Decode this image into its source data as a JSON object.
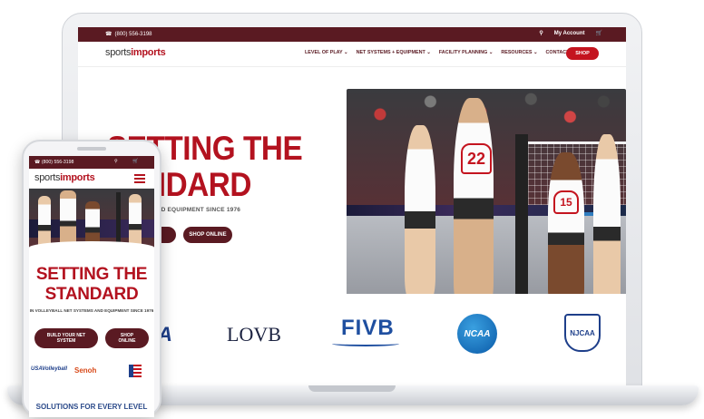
{
  "site": {
    "phone": "(800) 556-3198",
    "account_label": "My Account",
    "logo_prefix": "sports",
    "logo_suffix": "imports"
  },
  "nav": {
    "items": [
      "LEVEL OF PLAY",
      "NET SYSTEMS + EQUIPMENT",
      "FACILITY PLANNING",
      "RESOURCES",
      "CONTACT"
    ],
    "shop_label": "SHOP"
  },
  "hero": {
    "title_line1": "SETTING THE",
    "title_line2": "STANDARD",
    "subtitle": "IN VOLLEYBALL NET SYSTEMS AND EQUIPMENT SINCE 1976",
    "desktop_title_line1": "SETTING THE",
    "desktop_title_line2": "TANDARD",
    "desktop_subtitle": "NET SYSTEMS AND EQUIPMENT SINCE 1976",
    "build_label": "BUILD YOUR NET SYSTEM",
    "build_label_desktop": "STEM",
    "shop_online_label": "SHOP ONLINE",
    "jersey_left": "22",
    "jersey_right": "15",
    "banner_letter": "@"
  },
  "partners": {
    "usa": "A",
    "lovb": "LOVB",
    "fivb": "FIVB",
    "ncaa": "NCAA",
    "njcaa": "NJCAA"
  },
  "mobile": {
    "logos": [
      "USAVolleyball",
      "Senoh"
    ],
    "footer_heading": "SOLUTIONS FOR EVERY LEVEL"
  },
  "colors": {
    "brand_red": "#c4141f",
    "brand_maroon": "#5a1a22",
    "text_red": "#b3121f"
  }
}
